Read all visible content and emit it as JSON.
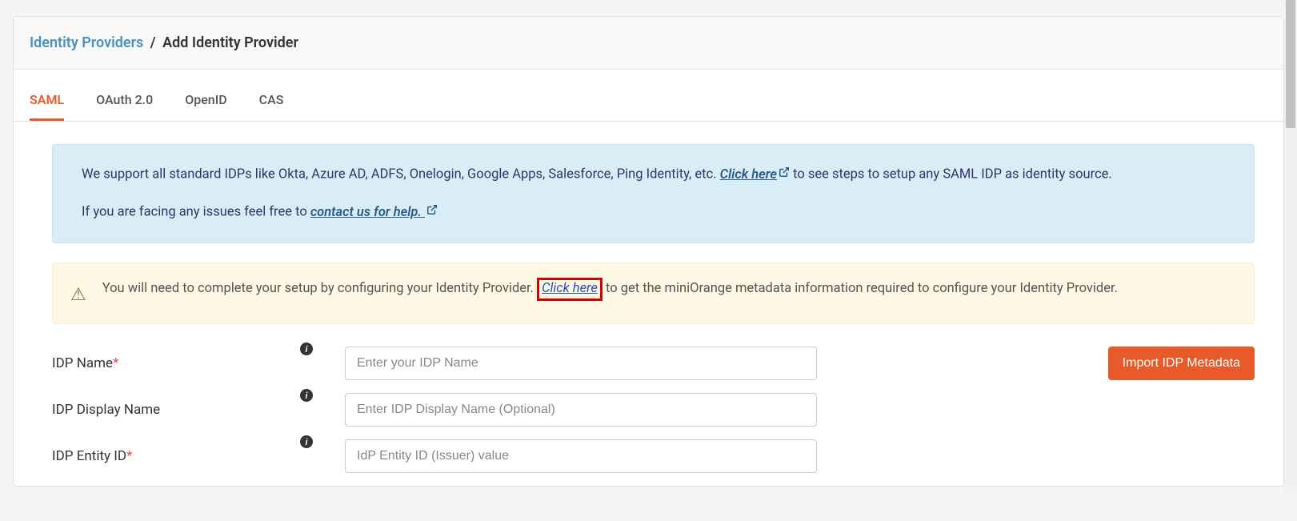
{
  "breadcrumb": {
    "parent": "Identity Providers",
    "separator": "/",
    "current": "Add Identity Provider"
  },
  "tabs": {
    "saml": "SAML",
    "oauth": "OAuth 2.0",
    "openid": "OpenID",
    "cas": "CAS"
  },
  "info": {
    "line1_a": "We support all standard IDPs like Okta, Azure AD, ADFS, Onelogin, Google Apps, Salesforce, Ping Identity, etc. ",
    "link1": "Click here",
    "line1_b": " to see steps to setup any SAML IDP as identity source.",
    "line2_a": "If you are facing any issues feel free to ",
    "link2": "contact us for help."
  },
  "warn": {
    "text_a": "You will need to complete your setup by configuring your Identity Provider. ",
    "link": "Click here",
    "text_b": " to get the miniOrange metadata information required to configure your Identity Provider."
  },
  "form": {
    "idp_name": {
      "label": "IDP Name",
      "required": "*",
      "placeholder": "Enter your IDP Name",
      "value": ""
    },
    "idp_display": {
      "label": "IDP Display Name",
      "placeholder": "Enter IDP Display Name (Optional)",
      "value": ""
    },
    "idp_entity": {
      "label": "IDP Entity ID",
      "required": "*",
      "placeholder": "IdP Entity ID (Issuer) value",
      "value": ""
    }
  },
  "buttons": {
    "import": "Import IDP Metadata"
  }
}
